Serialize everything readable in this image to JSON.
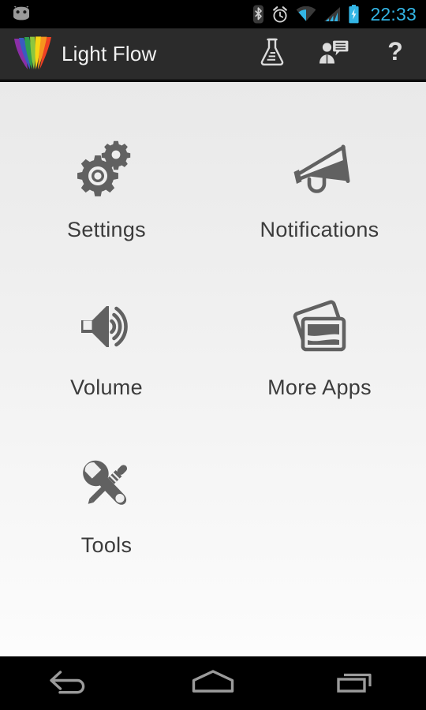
{
  "status_bar": {
    "left_icons": [
      {
        "name": "android-robot-icon",
        "label": "Android"
      }
    ],
    "right_icons": [
      {
        "name": "bluetooth-icon",
        "label": "Bluetooth"
      },
      {
        "name": "alarm-clock-icon",
        "label": "Alarm set"
      },
      {
        "name": "wifi-icon",
        "label": "Wi-Fi"
      },
      {
        "name": "cell-signal-icon",
        "label": "Mobile signal"
      },
      {
        "name": "battery-charging-icon",
        "label": "Battery charging"
      }
    ],
    "clock": "22:33",
    "clock_color": "#33b5e5",
    "background": "#000000"
  },
  "action_bar": {
    "title": "Light Flow",
    "background": "#2b2b2b",
    "title_color": "#f2f2f2",
    "logo": {
      "name": "light-flow-logo",
      "colors": [
        "#7b2fa0",
        "#3a57c4",
        "#3fa535",
        "#8dc63f",
        "#f5d415",
        "#f7941e",
        "#ef4023",
        "#d61f26"
      ]
    },
    "actions": [
      {
        "name": "beta-flask-button",
        "label": "Beta"
      },
      {
        "name": "feedback-button",
        "label": "Feedback"
      },
      {
        "name": "help-button",
        "label": "?"
      }
    ]
  },
  "main": {
    "background_top": "#e9e9e9",
    "background_bottom": "#fcfcfc",
    "icon_color": "#616161",
    "label_color": "#3b3b3b",
    "tiles": [
      {
        "label": "Settings",
        "icon": "gears-icon"
      },
      {
        "label": "Notifications",
        "icon": "megaphone-icon"
      },
      {
        "label": "Volume",
        "icon": "speaker-volume-icon"
      },
      {
        "label": "More Apps",
        "icon": "photos-stack-icon"
      },
      {
        "label": "Tools",
        "icon": "wrench-screwdriver-icon"
      }
    ]
  },
  "nav_bar": {
    "background": "#000000",
    "buttons": [
      {
        "name": "nav-back-button",
        "label": "Back"
      },
      {
        "name": "nav-home-button",
        "label": "Home"
      },
      {
        "name": "nav-recents-button",
        "label": "Recent apps"
      }
    ]
  }
}
